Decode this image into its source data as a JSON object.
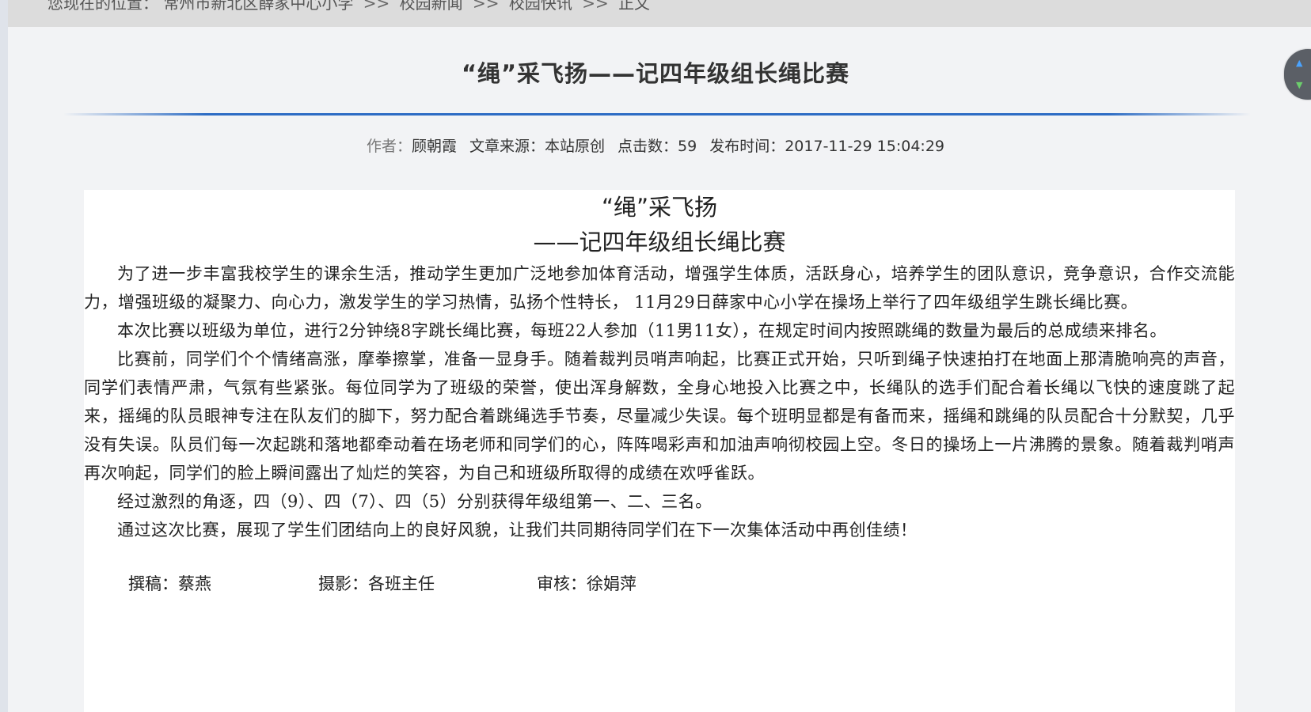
{
  "breadcrumb": {
    "prefix": "您现在的位置：",
    "items": [
      "常州市新北区薛家中心小学",
      "校园新闻",
      "校园快讯",
      "正文"
    ],
    "separator": ">>"
  },
  "article": {
    "title": "“绳”采飞扬——记四年级组长绳比赛",
    "meta": {
      "author_label": "作者：",
      "author": "顾朝霞",
      "source": "文章来源：本站原创",
      "clicks": "点击数：59",
      "published": "发布时间：2017-11-29 15:04:29"
    },
    "heading_line1": "“绳”采飞扬",
    "heading_line2": "——记四年级组长绳比赛",
    "paragraphs": [
      "为了进一步丰富我校学生的课余生活，推动学生更加广泛地参加体育活动，增强学生体质，活跃身心，培养学生的团队意识，竞争意识，合作交流能力，增强班级的凝聚力、向心力，激发学生的学习热情，弘扬个性特长， 11月29日薛家中心小学在操场上举行了四年级组学生跳长绳比赛。",
      "本次比赛以班级为单位，进行2分钟绕8字跳长绳比赛，每班22人参加（11男11女），在规定时间内按照跳绳的数量为最后的总成绩来排名。",
      "比赛前，同学们个个情绪高涨，摩拳擦掌，准备一显身手。随着裁判员哨声响起，比赛正式开始，只听到绳子快速拍打在地面上那清脆响亮的声音，同学们表情严肃，气氛有些紧张。每位同学为了班级的荣誉，使出浑身解数，全身心地投入比赛之中，长绳队的选手们配合着长绳以飞快的速度跳了起来，摇绳的队员眼神专注在队友们的脚下，努力配合着跳绳选手节奏，尽量减少失误。每个班明显都是有备而来，摇绳和跳绳的队员配合十分默契，几乎没有失误。队员们每一次起跳和落地都牵动着在场老师和同学们的心，阵阵喝彩声和加油声响彻校园上空。冬日的操场上一片沸腾的景象。随着裁判哨声再次响起，同学们的脸上瞬间露出了灿烂的笑容，为自己和班级所取得的成绩在欢呼雀跃。",
      "经过激烈的角逐，四（9）、四（7）、四（5）分别获得年级组第一、二、三名。",
      "通过这次比赛，展现了学生们团结向上的良好风貌，让我们共同期待同学们在下一次集体活动中再创佳绩！"
    ],
    "credits": {
      "writer": "撰稿：蔡燕",
      "photographer": "摄影：各班主任",
      "reviewer": "审核：徐娟萍"
    }
  },
  "scroll_widget": {
    "up_icon": "arrow-up-icon",
    "down_icon": "arrow-down-icon",
    "up_color": "#4aa3ff",
    "down_color": "#6ccf6c"
  },
  "colors": {
    "accent_rule": "#2d6cc4",
    "page_bg": "#f2f3f5",
    "content_bg": "#ffffff"
  }
}
